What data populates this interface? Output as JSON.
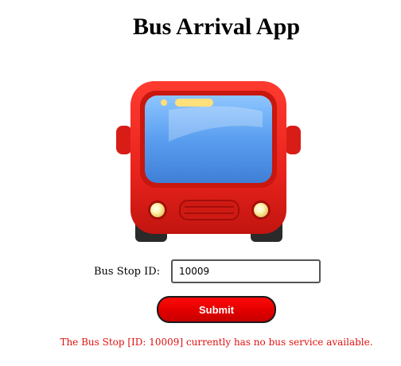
{
  "app": {
    "title": "Bus Arrival App"
  },
  "illustration": {
    "icon": "bus-front-icon",
    "body_color": "#e8231c",
    "window_color": "#5a9ef0",
    "headlight_color": "#fff3b0"
  },
  "form": {
    "stop_id_label": "Bus Stop ID:",
    "stop_id_value": "10009",
    "submit_label": "Submit"
  },
  "status": {
    "message": "The Bus Stop [ID: 10009] currently has no bus service available.",
    "color": "#e01010"
  },
  "colors": {
    "button_red": "#e20000",
    "button_border": "#1a1a1a"
  }
}
